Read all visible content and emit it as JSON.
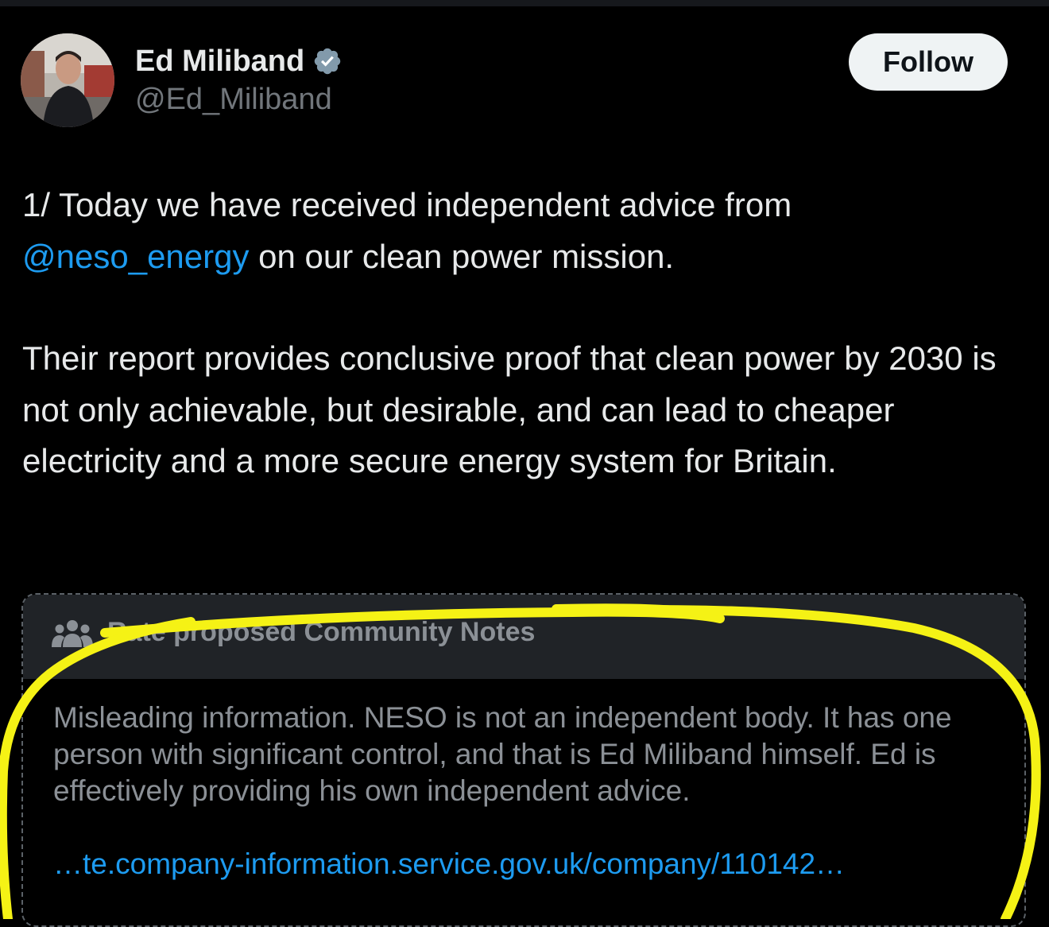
{
  "author": {
    "display_name": "Ed Miliband",
    "handle": "@Ed_Miliband",
    "verified": true,
    "avatar_icon": "profile-photo"
  },
  "follow_label": "Follow",
  "tweet": {
    "line1_text": "1/ Today we have received independent advice from ",
    "mention": "@neso_energy",
    "line1_rest": " on our clean power mission.",
    "paragraph2": "Their report provides conclusive proof that clean power by 2030 is not only achievable, but desirable, and can lead to cheaper electricity and a more secure energy system for Britain."
  },
  "community_note": {
    "header_icon": "people-icon",
    "header_label": "Rate proposed Community Notes",
    "body": "Misleading information. NESO is not an independent body. It has one person with significant control, and that is Ed Miliband himself. Ed is effectively providing his own independent advice.",
    "link": "…te.company-information.service.gov.uk/company/110142…"
  },
  "colors": {
    "background": "#000000",
    "text": "#e7e9ea",
    "muted": "#71767b",
    "link": "#1d9bf0",
    "verified": "#829aab",
    "note_header_bg": "#202327",
    "annotation": "#f5f215"
  }
}
